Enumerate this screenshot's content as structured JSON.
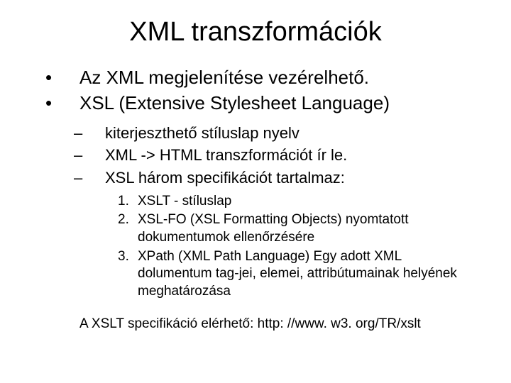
{
  "title": "XML transzformációk",
  "bullets": [
    "Az XML megjelenítése vezérelhető.",
    "XSL (Extensive Stylesheet Language)"
  ],
  "subbullets": [
    "kiterjeszthető stíluslap nyelv",
    "XML -> HTML transzformációt ír le.",
    "XSL három specifikációt tartalmaz:"
  ],
  "numbered": [
    "XSLT - stíluslap",
    "XSL-FO (XSL Formatting Objects) nyomtatott dokumentumok ellenőrzésére",
    "XPath (XML Path Language) Egy adott XML dolumentum tag-jei, elemei, attribútumainak helyének meghatározása"
  ],
  "footer": "A XSLT specifikáció elérhető: http: //www. w3. org/TR/xslt"
}
